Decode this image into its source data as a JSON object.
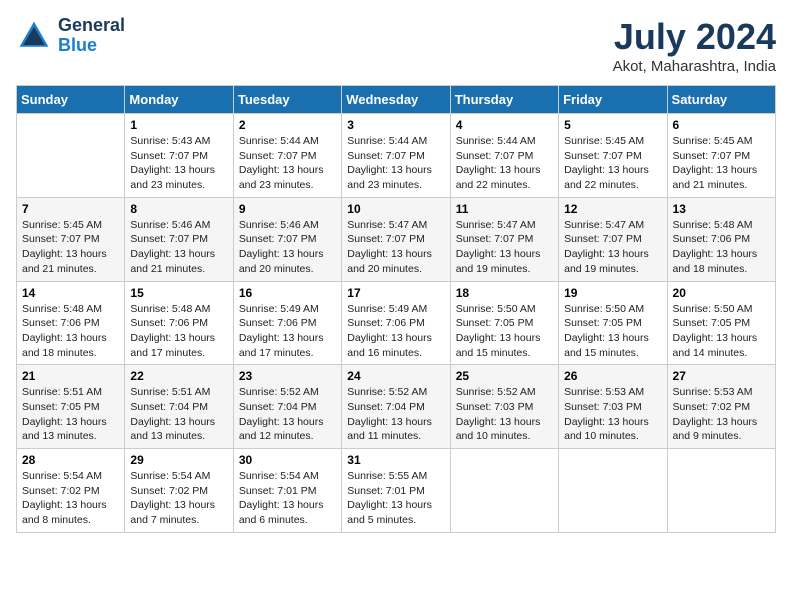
{
  "header": {
    "logo_line1": "General",
    "logo_line2": "Blue",
    "month": "July 2024",
    "location": "Akot, Maharashtra, India"
  },
  "days_of_week": [
    "Sunday",
    "Monday",
    "Tuesday",
    "Wednesday",
    "Thursday",
    "Friday",
    "Saturday"
  ],
  "weeks": [
    [
      {
        "day": "",
        "sunrise": "",
        "sunset": "",
        "daylight": ""
      },
      {
        "day": "1",
        "sunrise": "Sunrise: 5:43 AM",
        "sunset": "Sunset: 7:07 PM",
        "daylight": "Daylight: 13 hours and 23 minutes."
      },
      {
        "day": "2",
        "sunrise": "Sunrise: 5:44 AM",
        "sunset": "Sunset: 7:07 PM",
        "daylight": "Daylight: 13 hours and 23 minutes."
      },
      {
        "day": "3",
        "sunrise": "Sunrise: 5:44 AM",
        "sunset": "Sunset: 7:07 PM",
        "daylight": "Daylight: 13 hours and 23 minutes."
      },
      {
        "day": "4",
        "sunrise": "Sunrise: 5:44 AM",
        "sunset": "Sunset: 7:07 PM",
        "daylight": "Daylight: 13 hours and 22 minutes."
      },
      {
        "day": "5",
        "sunrise": "Sunrise: 5:45 AM",
        "sunset": "Sunset: 7:07 PM",
        "daylight": "Daylight: 13 hours and 22 minutes."
      },
      {
        "day": "6",
        "sunrise": "Sunrise: 5:45 AM",
        "sunset": "Sunset: 7:07 PM",
        "daylight": "Daylight: 13 hours and 21 minutes."
      }
    ],
    [
      {
        "day": "7",
        "sunrise": "Sunrise: 5:45 AM",
        "sunset": "Sunset: 7:07 PM",
        "daylight": "Daylight: 13 hours and 21 minutes."
      },
      {
        "day": "8",
        "sunrise": "Sunrise: 5:46 AM",
        "sunset": "Sunset: 7:07 PM",
        "daylight": "Daylight: 13 hours and 21 minutes."
      },
      {
        "day": "9",
        "sunrise": "Sunrise: 5:46 AM",
        "sunset": "Sunset: 7:07 PM",
        "daylight": "Daylight: 13 hours and 20 minutes."
      },
      {
        "day": "10",
        "sunrise": "Sunrise: 5:47 AM",
        "sunset": "Sunset: 7:07 PM",
        "daylight": "Daylight: 13 hours and 20 minutes."
      },
      {
        "day": "11",
        "sunrise": "Sunrise: 5:47 AM",
        "sunset": "Sunset: 7:07 PM",
        "daylight": "Daylight: 13 hours and 19 minutes."
      },
      {
        "day": "12",
        "sunrise": "Sunrise: 5:47 AM",
        "sunset": "Sunset: 7:07 PM",
        "daylight": "Daylight: 13 hours and 19 minutes."
      },
      {
        "day": "13",
        "sunrise": "Sunrise: 5:48 AM",
        "sunset": "Sunset: 7:06 PM",
        "daylight": "Daylight: 13 hours and 18 minutes."
      }
    ],
    [
      {
        "day": "14",
        "sunrise": "Sunrise: 5:48 AM",
        "sunset": "Sunset: 7:06 PM",
        "daylight": "Daylight: 13 hours and 18 minutes."
      },
      {
        "day": "15",
        "sunrise": "Sunrise: 5:48 AM",
        "sunset": "Sunset: 7:06 PM",
        "daylight": "Daylight: 13 hours and 17 minutes."
      },
      {
        "day": "16",
        "sunrise": "Sunrise: 5:49 AM",
        "sunset": "Sunset: 7:06 PM",
        "daylight": "Daylight: 13 hours and 17 minutes."
      },
      {
        "day": "17",
        "sunrise": "Sunrise: 5:49 AM",
        "sunset": "Sunset: 7:06 PM",
        "daylight": "Daylight: 13 hours and 16 minutes."
      },
      {
        "day": "18",
        "sunrise": "Sunrise: 5:50 AM",
        "sunset": "Sunset: 7:05 PM",
        "daylight": "Daylight: 13 hours and 15 minutes."
      },
      {
        "day": "19",
        "sunrise": "Sunrise: 5:50 AM",
        "sunset": "Sunset: 7:05 PM",
        "daylight": "Daylight: 13 hours and 15 minutes."
      },
      {
        "day": "20",
        "sunrise": "Sunrise: 5:50 AM",
        "sunset": "Sunset: 7:05 PM",
        "daylight": "Daylight: 13 hours and 14 minutes."
      }
    ],
    [
      {
        "day": "21",
        "sunrise": "Sunrise: 5:51 AM",
        "sunset": "Sunset: 7:05 PM",
        "daylight": "Daylight: 13 hours and 13 minutes."
      },
      {
        "day": "22",
        "sunrise": "Sunrise: 5:51 AM",
        "sunset": "Sunset: 7:04 PM",
        "daylight": "Daylight: 13 hours and 13 minutes."
      },
      {
        "day": "23",
        "sunrise": "Sunrise: 5:52 AM",
        "sunset": "Sunset: 7:04 PM",
        "daylight": "Daylight: 13 hours and 12 minutes."
      },
      {
        "day": "24",
        "sunrise": "Sunrise: 5:52 AM",
        "sunset": "Sunset: 7:04 PM",
        "daylight": "Daylight: 13 hours and 11 minutes."
      },
      {
        "day": "25",
        "sunrise": "Sunrise: 5:52 AM",
        "sunset": "Sunset: 7:03 PM",
        "daylight": "Daylight: 13 hours and 10 minutes."
      },
      {
        "day": "26",
        "sunrise": "Sunrise: 5:53 AM",
        "sunset": "Sunset: 7:03 PM",
        "daylight": "Daylight: 13 hours and 10 minutes."
      },
      {
        "day": "27",
        "sunrise": "Sunrise: 5:53 AM",
        "sunset": "Sunset: 7:02 PM",
        "daylight": "Daylight: 13 hours and 9 minutes."
      }
    ],
    [
      {
        "day": "28",
        "sunrise": "Sunrise: 5:54 AM",
        "sunset": "Sunset: 7:02 PM",
        "daylight": "Daylight: 13 hours and 8 minutes."
      },
      {
        "day": "29",
        "sunrise": "Sunrise: 5:54 AM",
        "sunset": "Sunset: 7:02 PM",
        "daylight": "Daylight: 13 hours and 7 minutes."
      },
      {
        "day": "30",
        "sunrise": "Sunrise: 5:54 AM",
        "sunset": "Sunset: 7:01 PM",
        "daylight": "Daylight: 13 hours and 6 minutes."
      },
      {
        "day": "31",
        "sunrise": "Sunrise: 5:55 AM",
        "sunset": "Sunset: 7:01 PM",
        "daylight": "Daylight: 13 hours and 5 minutes."
      },
      {
        "day": "",
        "sunrise": "",
        "sunset": "",
        "daylight": ""
      },
      {
        "day": "",
        "sunrise": "",
        "sunset": "",
        "daylight": ""
      },
      {
        "day": "",
        "sunrise": "",
        "sunset": "",
        "daylight": ""
      }
    ]
  ]
}
